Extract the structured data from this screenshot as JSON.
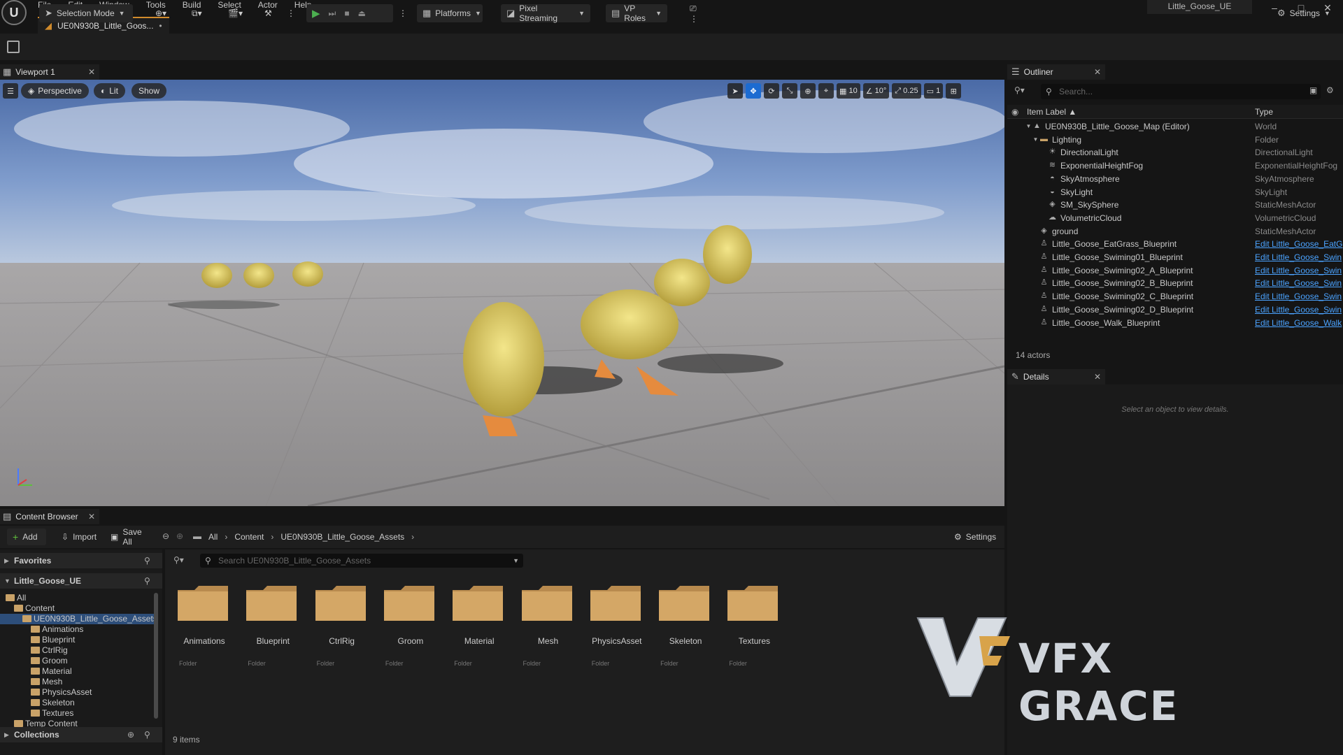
{
  "menu": [
    "File",
    "Edit",
    "Window",
    "Tools",
    "Build",
    "Select",
    "Actor",
    "Help"
  ],
  "window_title": "Little_Goose_UE",
  "doc_tab": "UE0N930B_Little_Goos...",
  "toolbar": {
    "selection_mode": "Selection Mode",
    "platforms": "Platforms",
    "pixel_streaming": "Pixel Streaming",
    "vp_roles": "VP Roles",
    "settings": "Settings"
  },
  "viewport": {
    "tab": "Viewport 1",
    "perspective": "Perspective",
    "lit": "Lit",
    "show": "Show",
    "grid_snap": "10",
    "angle_snap": "10°",
    "scale_snap": "0.25",
    "camera_speed": "1"
  },
  "outliner": {
    "tab": "Outliner",
    "search_placeholder": "Search...",
    "col_label": "Item Label",
    "col_type": "Type",
    "rows": [
      {
        "label": "UE0N930B_Little_Goose_Map (Editor)",
        "type": "World",
        "indent": 0,
        "icon": "world-icon"
      },
      {
        "label": "Lighting",
        "type": "Folder",
        "indent": 1,
        "icon": "folder-icon"
      },
      {
        "label": "DirectionalLight",
        "type": "DirectionalLight",
        "indent": 2,
        "icon": "sun-icon"
      },
      {
        "label": "ExponentialHeightFog",
        "type": "ExponentialHeightFog",
        "indent": 2,
        "icon": "fog-icon"
      },
      {
        "label": "SkyAtmosphere",
        "type": "SkyAtmosphere",
        "indent": 2,
        "icon": "atmosphere-icon"
      },
      {
        "label": "SkyLight",
        "type": "SkyLight",
        "indent": 2,
        "icon": "skylight-icon"
      },
      {
        "label": "SM_SkySphere",
        "type": "StaticMeshActor",
        "indent": 2,
        "icon": "mesh-icon"
      },
      {
        "label": "VolumetricCloud",
        "type": "VolumetricCloud",
        "indent": 2,
        "icon": "cloud-icon"
      },
      {
        "label": "ground",
        "type": "StaticMeshActor",
        "indent": 1,
        "icon": "mesh-icon"
      },
      {
        "label": "Little_Goose_EatGrass_Blueprint",
        "type": "Edit Little_Goose_EatG",
        "indent": 1,
        "icon": "pawn-icon",
        "link": true
      },
      {
        "label": "Little_Goose_Swiming01_Blueprint",
        "type": "Edit Little_Goose_Swin",
        "indent": 1,
        "icon": "pawn-icon",
        "link": true
      },
      {
        "label": "Little_Goose_Swiming02_A_Blueprint",
        "type": "Edit Little_Goose_Swin",
        "indent": 1,
        "icon": "pawn-icon",
        "link": true
      },
      {
        "label": "Little_Goose_Swiming02_B_Blueprint",
        "type": "Edit Little_Goose_Swin",
        "indent": 1,
        "icon": "pawn-icon",
        "link": true
      },
      {
        "label": "Little_Goose_Swiming02_C_Blueprint",
        "type": "Edit Little_Goose_Swin",
        "indent": 1,
        "icon": "pawn-icon",
        "link": true
      },
      {
        "label": "Little_Goose_Swiming02_D_Blueprint",
        "type": "Edit Little_Goose_Swin",
        "indent": 1,
        "icon": "pawn-icon",
        "link": true
      },
      {
        "label": "Little_Goose_Walk_Blueprint",
        "type": "Edit Little_Goose_Walk",
        "indent": 1,
        "icon": "pawn-icon",
        "link": true
      }
    ],
    "actor_count": "14 actors"
  },
  "details": {
    "tab": "Details",
    "empty_message": "Select an object to view details."
  },
  "content_browser": {
    "tab": "Content Browser",
    "add": "Add",
    "import": "Import",
    "save_all": "Save All",
    "breadcrumb": [
      "All",
      "Content",
      "UE0N930B_Little_Goose_Assets"
    ],
    "settings": "Settings",
    "favorites": "Favorites",
    "project": "Little_Goose_UE",
    "collections": "Collections",
    "search_placeholder": "Search UE0N930B_Little_Goose_Assets",
    "tree": [
      {
        "label": "All",
        "indent": 0
      },
      {
        "label": "Content",
        "indent": 1
      },
      {
        "label": "UE0N930B_Little_Goose_Assets",
        "indent": 2,
        "selected": true
      },
      {
        "label": "Animations",
        "indent": 3
      },
      {
        "label": "Blueprint",
        "indent": 3
      },
      {
        "label": "CtrlRig",
        "indent": 3
      },
      {
        "label": "Groom",
        "indent": 3
      },
      {
        "label": "Material",
        "indent": 3
      },
      {
        "label": "Mesh",
        "indent": 3
      },
      {
        "label": "PhysicsAsset",
        "indent": 3
      },
      {
        "label": "Skeleton",
        "indent": 3
      },
      {
        "label": "Textures",
        "indent": 3
      },
      {
        "label": "Temp Content",
        "indent": 1
      }
    ],
    "folders": [
      {
        "name": "Animations",
        "type": "Folder"
      },
      {
        "name": "Blueprint",
        "type": "Folder"
      },
      {
        "name": "CtrlRig",
        "type": "Folder"
      },
      {
        "name": "Groom",
        "type": "Folder"
      },
      {
        "name": "Material",
        "type": "Folder"
      },
      {
        "name": "Mesh",
        "type": "Folder"
      },
      {
        "name": "PhysicsAsset",
        "type": "Folder"
      },
      {
        "name": "Skeleton",
        "type": "Folder"
      },
      {
        "name": "Textures",
        "type": "Folder"
      }
    ],
    "item_count": "9 items"
  },
  "watermark": "VFX GRACE",
  "colors": {
    "accent": "#d18b2c",
    "select": "#1c6bd1",
    "link": "#4ba3ff",
    "folder": "#c9a268"
  }
}
